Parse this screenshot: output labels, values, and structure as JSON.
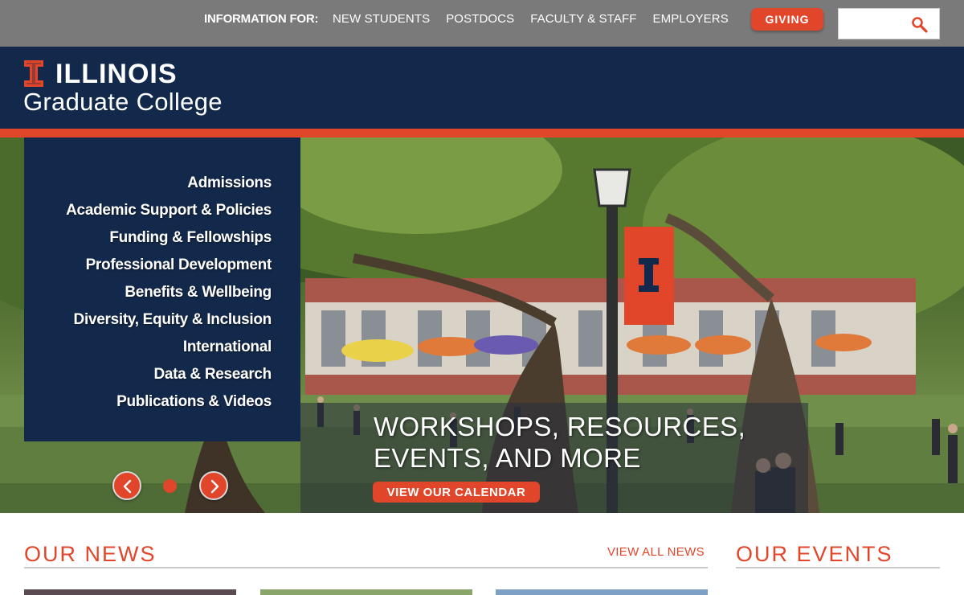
{
  "topbar": {
    "info_label": "INFORMATION FOR:",
    "links": [
      "NEW STUDENTS",
      "POSTDOCS",
      "FACULTY & STAFF",
      "EMPLOYERS"
    ],
    "giving_label": "GIVING",
    "search_value": ""
  },
  "brand": {
    "name": "ILLINOIS",
    "subtitle": "Graduate College"
  },
  "side_nav": {
    "items": [
      "Admissions",
      "Academic Support & Policies",
      "Funding & Fellowships",
      "Professional Development",
      "Benefits & Wellbeing",
      "Diversity, Equity & Inclusion",
      "International",
      "Data & Research",
      "Publications & Videos"
    ]
  },
  "hero": {
    "caption": "WORKSHOPS, RESOURCES, EVENTS, AND MORE",
    "button_label": "VIEW OUR CALENDAR",
    "slide_count": 1,
    "active_slide": 1
  },
  "news": {
    "heading": "OUR NEWS",
    "view_all_label": "VIEW ALL NEWS"
  },
  "events": {
    "heading": "OUR EVENTS"
  },
  "colors": {
    "navy": "#13294b",
    "orange": "#e1462a",
    "topbar_gray": "#7a7a7a"
  },
  "icons": {
    "search": "search-icon",
    "block_i": "block-i-logo",
    "prev": "chevron-left-icon",
    "next": "chevron-right-icon"
  }
}
